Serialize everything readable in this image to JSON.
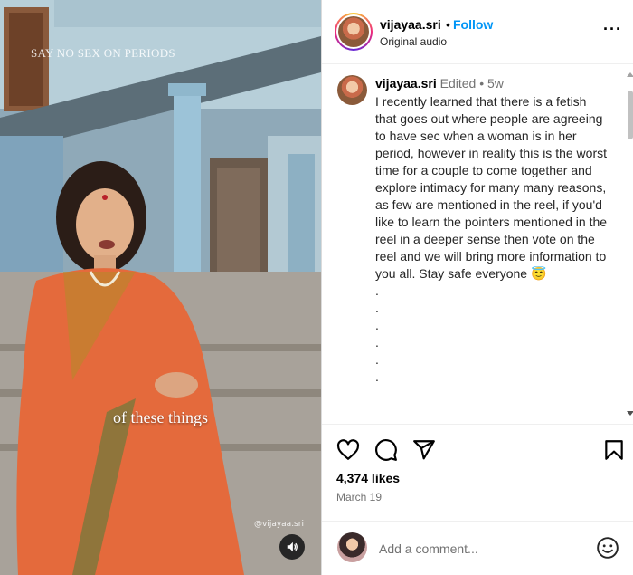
{
  "video": {
    "overlay_text": "SAY NO SEX ON PERIODS",
    "caption": "of these things",
    "watermark": "@vijayaa.sri"
  },
  "header": {
    "username": "vijayaa.sri",
    "separator": "•",
    "follow_label": "Follow",
    "audio_label": "Original audio",
    "more_label": "···"
  },
  "post_comment": {
    "username": "vijayaa.sri",
    "edited_label": "Edited",
    "separator": "•",
    "time_ago": "5w",
    "text": "I recently learned that there is a fetish that goes out where people are agreeing to have sec when a woman is in her period, however in reality this is the worst time for a couple to come together and explore intimacy for many many reasons, as few are mentioned in the reel, if you'd like to learn the pointers mentioned in the reel in a deeper sense then vote on the reel and we will bring more information to you all. Stay safe everyone 😇",
    "dots": [
      ".",
      ".",
      ".",
      ".",
      ".",
      "."
    ]
  },
  "engagement": {
    "likes": "4,374 likes",
    "date": "March 19"
  },
  "add_comment": {
    "placeholder": "Add a comment..."
  },
  "colors": {
    "follow_blue": "#0095f6",
    "muted_gray": "#737373",
    "border": "#dbdbdb"
  },
  "icons": [
    "heart-icon",
    "comment-icon",
    "share-icon",
    "bookmark-icon",
    "emoji-icon",
    "speaker-icon",
    "more-icon"
  ]
}
